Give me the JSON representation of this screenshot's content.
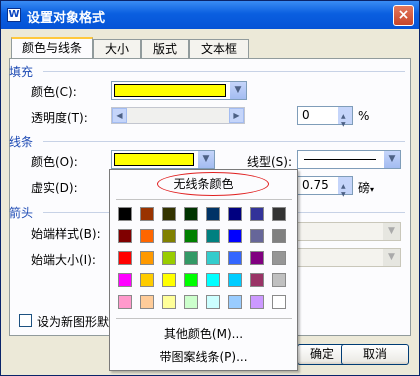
{
  "window": {
    "title": "设置对象格式",
    "icon": "wps-writer-icon",
    "close_label": "×"
  },
  "tabs": [
    {
      "label": "颜色与线条",
      "active": true
    },
    {
      "label": "大小",
      "active": false
    },
    {
      "label": "版式",
      "active": false
    },
    {
      "label": "文本框",
      "active": false
    }
  ],
  "fill": {
    "section_label": "填充",
    "color_label": "颜色(C):",
    "color_value": "#ffff00",
    "transparency_label": "透明度(T):",
    "transparency_value": "0",
    "transparency_unit": "%"
  },
  "line": {
    "section_label": "线条",
    "color_label": "颜色(O):",
    "color_value": "#ffff00",
    "linetype_label": "线型(S):",
    "dash_label": "虚实(D):",
    "weight_value": "0.75",
    "weight_unit": "磅"
  },
  "arrows": {
    "section_label": "箭头",
    "begin_style_label": "始端样式(B):",
    "begin_size_label": "始端大小(I):"
  },
  "default_checkbox_label": "设为新图形默",
  "buttons": {
    "ok": "确定",
    "cancel": "取消"
  },
  "color_popup": {
    "no_line_label": "无线条颜色",
    "more_colors_label": "其他颜色(M)...",
    "pattern_lines_label": "带图案线条(P)...",
    "palette": [
      [
        "#000000",
        "#993300",
        "#333300",
        "#003300",
        "#003366",
        "#000080",
        "#333399",
        "#333333"
      ],
      [
        "#800000",
        "#ff6600",
        "#808000",
        "#008000",
        "#008080",
        "#0000ff",
        "#666699",
        "#808080"
      ],
      [
        "#ff0000",
        "#ff9900",
        "#99cc00",
        "#339966",
        "#33cccc",
        "#3366ff",
        "#800080",
        "#969696"
      ],
      [
        "#ff00ff",
        "#ffcc00",
        "#ffff00",
        "#00ff00",
        "#00ffff",
        "#00ccff",
        "#993366",
        "#c0c0c0"
      ],
      [
        "#ff99cc",
        "#ffcc99",
        "#ffff99",
        "#ccffcc",
        "#ccffff",
        "#99ccff",
        "#cc99ff",
        "#ffffff"
      ]
    ]
  }
}
